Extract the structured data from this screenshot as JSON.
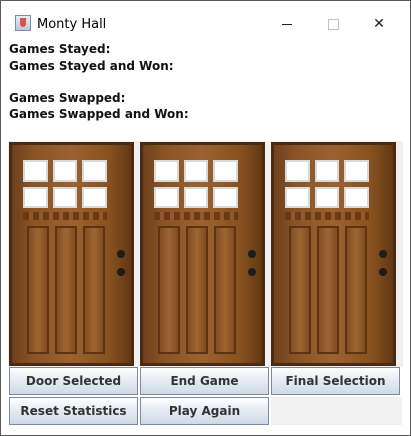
{
  "window": {
    "title": "Monty Hall"
  },
  "stats": {
    "stayed": "Games Stayed:",
    "stayed_won": "Games Stayed and Won:",
    "swapped": "Games Swapped:",
    "swapped_won": "Games Swapped and Won:"
  },
  "buttons": {
    "door_selected": "Door Selected",
    "end_game": "End Game",
    "final_selection": "Final Selection",
    "reset_statistics": "Reset Statistics",
    "play_again": "Play Again"
  },
  "icons": {
    "app": "java-cup-icon",
    "minimize": "minimize-icon",
    "maximize": "maximize-icon",
    "close": "close-icon"
  }
}
